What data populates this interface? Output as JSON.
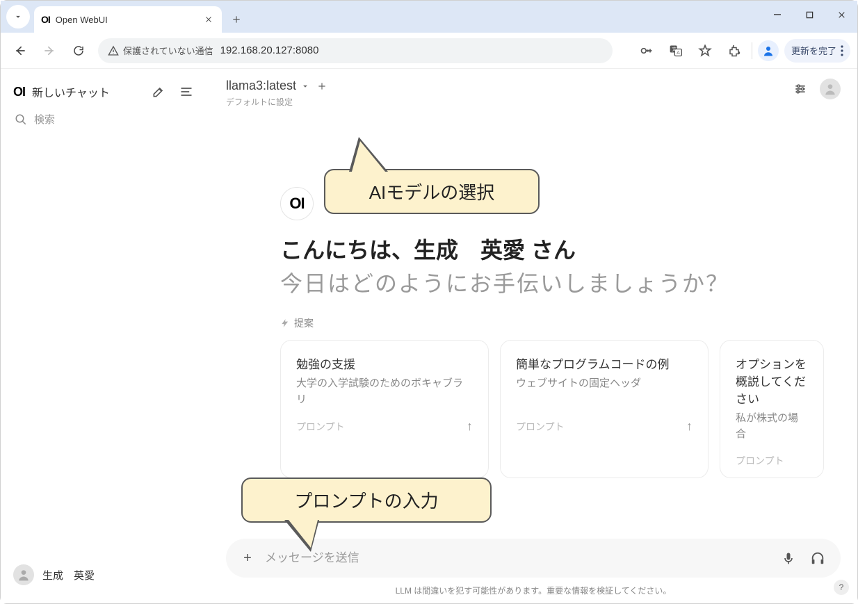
{
  "browser": {
    "tab_title": "Open WebUI",
    "security_label": "保護されていない通信",
    "url": "192.168.20.127:8080",
    "update_label": "更新を完了"
  },
  "sidebar": {
    "logo": "OI",
    "new_chat": "新しいチャット",
    "search_placeholder": "検索",
    "user_name": "生成　英愛"
  },
  "header": {
    "model": "llama3:latest",
    "set_default": "デフォルトに設定"
  },
  "greeting": {
    "logo": "OI",
    "line1": "こんにちは、生成　英愛 さん",
    "line2": "今日はどのようにお手伝いしましょうか？",
    "suggest_label": "提案"
  },
  "cards": [
    {
      "title": "勉強の支援",
      "desc": "大学の入学試験のためのボキャブラリ",
      "footer": "プロンプト"
    },
    {
      "title": "簡単なプログラムコードの例",
      "desc": "ウェブサイトの固定ヘッダ",
      "footer": "プロンプト"
    },
    {
      "title": "オプションを概説してください",
      "desc": "私が株式の場合",
      "footer": "プロンプト"
    }
  ],
  "input": {
    "placeholder": "メッセージを送信"
  },
  "disclaimer": "LLM は間違いを犯す可能性があります。重要な情報を検証してください。",
  "callouts": {
    "model_select": "AIモデルの選択",
    "prompt_input": "プロンプトの入力"
  },
  "help": "?"
}
